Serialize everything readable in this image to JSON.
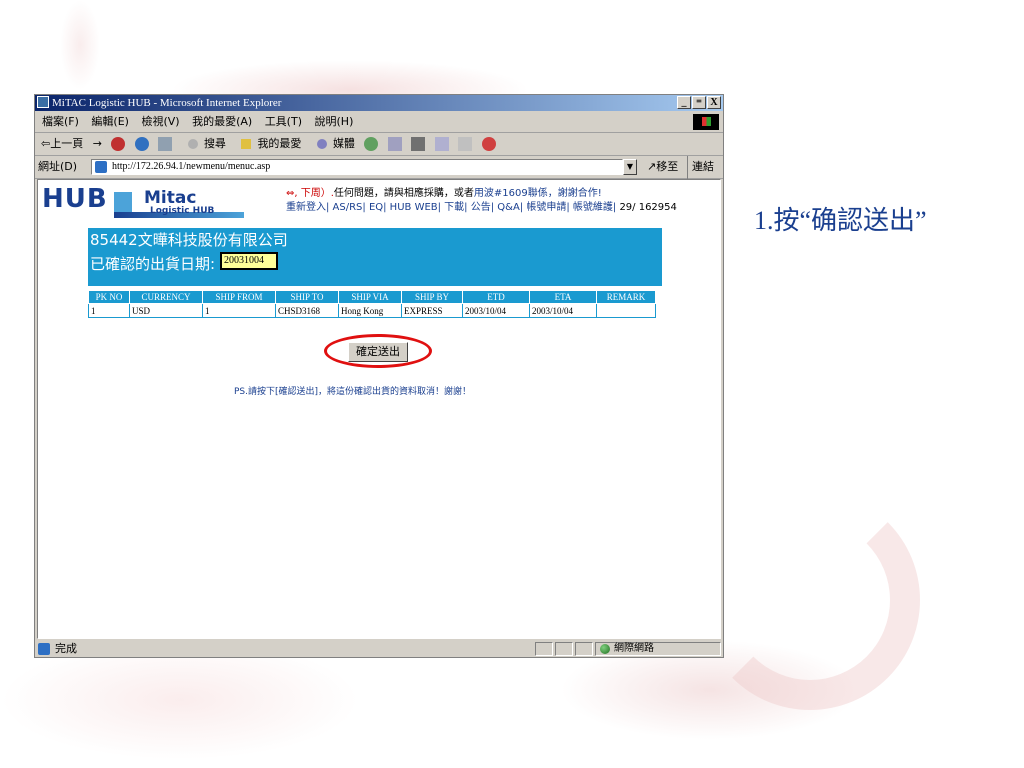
{
  "window": {
    "title": "MiTAC Logistic HUB - Microsoft Internet Explorer",
    "controls": [
      "_",
      "゠",
      "X"
    ]
  },
  "menu": [
    "檔案(F)",
    "編輯(E)",
    "檢視(V)",
    "我的最愛(A)",
    "工具(T)",
    "說明(H)"
  ],
  "toolbar": {
    "back": "⇦上一頁",
    "search": "搜尋",
    "favorites": "我的最愛",
    "media": "媒體"
  },
  "address": {
    "label": "網址(D)",
    "url": "http://172.26.94.1/newmenu/menuc.asp",
    "go": "↗移至",
    "links": "連結 »"
  },
  "header": {
    "logo_hub": "HUB",
    "logo_mitac": "Mitac",
    "logo_sub": "Logistic HUB",
    "notice_line1_red": "⇔, 下周）.",
    "notice_line1_black": "任何問題，請與相應採購，或者",
    "notice_line1_blue": "用波#1609聯係，謝謝合作!",
    "notice_line2": "重新登入| AS/RS| EQ| HUB WEB| 下載| 公告| Q&A| 帳號申請| 帳號維護|",
    "notice_line2_num": "29/   162954"
  },
  "company": {
    "name": "85442文曄科技股份有限公司",
    "date_label": "已確認的出貨日期:",
    "date_value": "20031004"
  },
  "table": {
    "headers": [
      "PK NO",
      "CURRENCY",
      "SHIP FROM",
      "SHIP TO",
      "SHIP VIA",
      "SHIP BY",
      "ETD",
      "ETA",
      "REMARK"
    ],
    "rows": [
      [
        "1",
        "USD",
        "1",
        "CHSD3168",
        "Hong Kong",
        "EXPRESS",
        "2003/10/04",
        "2003/10/04",
        ""
      ]
    ]
  },
  "confirm_button": "確定送出",
  "ps_note": "PS.請按下[確認送出]，將這份確認出貨的資料取消！謝謝！",
  "status": {
    "text": "完成",
    "zone": "網際網路"
  },
  "instruction": "1.按“确認送出”"
}
